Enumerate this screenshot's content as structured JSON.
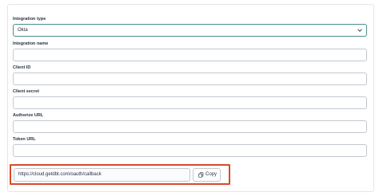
{
  "form": {
    "integration_type": {
      "label": "Integration type",
      "value": "Okta"
    },
    "integration_name": {
      "label": "Integration name",
      "value": ""
    },
    "client_id": {
      "label": "Client ID",
      "value": ""
    },
    "client_secret": {
      "label": "Client secret",
      "value": ""
    },
    "authorize_url": {
      "label": "Authorize URL",
      "value": ""
    },
    "token_url": {
      "label": "Token URL",
      "value": ""
    }
  },
  "callback": {
    "url": "https://cloud.getdbt.com/oauth/callback",
    "copy_label": "Copy"
  },
  "colors": {
    "highlight": "#d84a2c",
    "focus_border": "#4a8f8c"
  },
  "icons": {
    "dropdown": "chevron-down-icon",
    "copy": "copy-icon"
  }
}
